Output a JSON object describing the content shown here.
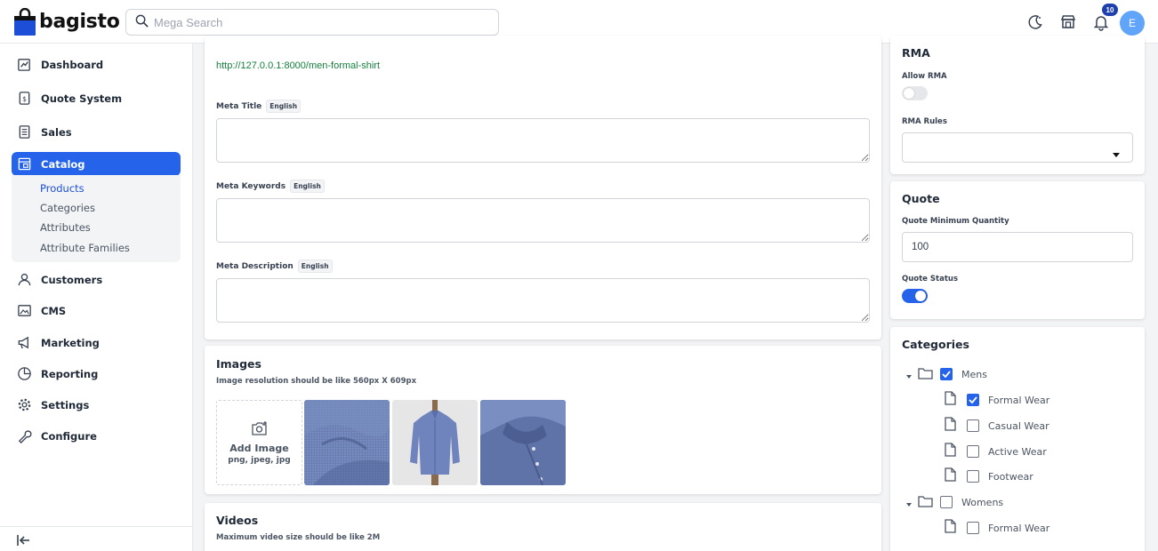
{
  "brand": {
    "name": "bagisto",
    "color": "#1d4ed8"
  },
  "search": {
    "placeholder": "Mega Search"
  },
  "header": {
    "notification_count": "10",
    "avatar_initial": "E"
  },
  "sidebar": {
    "items": [
      {
        "label": "Dashboard",
        "icon": "dashboard-icon"
      },
      {
        "label": "Quote System",
        "icon": "quote-icon"
      },
      {
        "label": "Sales",
        "icon": "sales-icon"
      },
      {
        "label": "Catalog",
        "icon": "catalog-icon"
      },
      {
        "label": "Customers",
        "icon": "customers-icon"
      },
      {
        "label": "CMS",
        "icon": "cms-icon"
      },
      {
        "label": "Marketing",
        "icon": "marketing-icon"
      },
      {
        "label": "Reporting",
        "icon": "reporting-icon"
      },
      {
        "label": "Settings",
        "icon": "settings-icon"
      },
      {
        "label": "Configure",
        "icon": "configure-icon"
      }
    ],
    "catalog_sub": [
      "Products",
      "Categories",
      "Attributes",
      "Attribute Families"
    ],
    "active_color": "#2563eb"
  },
  "seo": {
    "url": "http://127.0.0.1:8000/men-formal-shirt",
    "meta_title_label": "Meta Title",
    "meta_keywords_label": "Meta Keywords",
    "meta_description_label": "Meta Description",
    "lang": "English"
  },
  "images": {
    "title": "Images",
    "subtitle": "Image resolution should be like 560px X 609px",
    "add_label": "Add Image",
    "add_formats": "png, jpeg, jpg"
  },
  "videos": {
    "title": "Videos",
    "subtitle": "Maximum video size should be like 2M"
  },
  "rma": {
    "title": "RMA",
    "allow_label": "Allow RMA",
    "allow_enabled": false,
    "rules_label": "RMA Rules"
  },
  "quote": {
    "title": "Quote",
    "min_qty_label": "Quote Minimum Quantity",
    "min_qty_value": "100",
    "status_label": "Quote Status",
    "status_enabled": true
  },
  "categories": {
    "title": "Categories",
    "tree": [
      {
        "label": "Mens",
        "type": "folder",
        "checked": true
      },
      {
        "label": "Formal Wear",
        "type": "file",
        "checked": true
      },
      {
        "label": "Casual Wear",
        "type": "file",
        "checked": false
      },
      {
        "label": "Active Wear",
        "type": "file",
        "checked": false
      },
      {
        "label": "Footwear",
        "type": "file",
        "checked": false
      },
      {
        "label": "Womens",
        "type": "folder",
        "checked": false
      },
      {
        "label": "Formal Wear",
        "type": "file",
        "checked": false
      }
    ]
  }
}
